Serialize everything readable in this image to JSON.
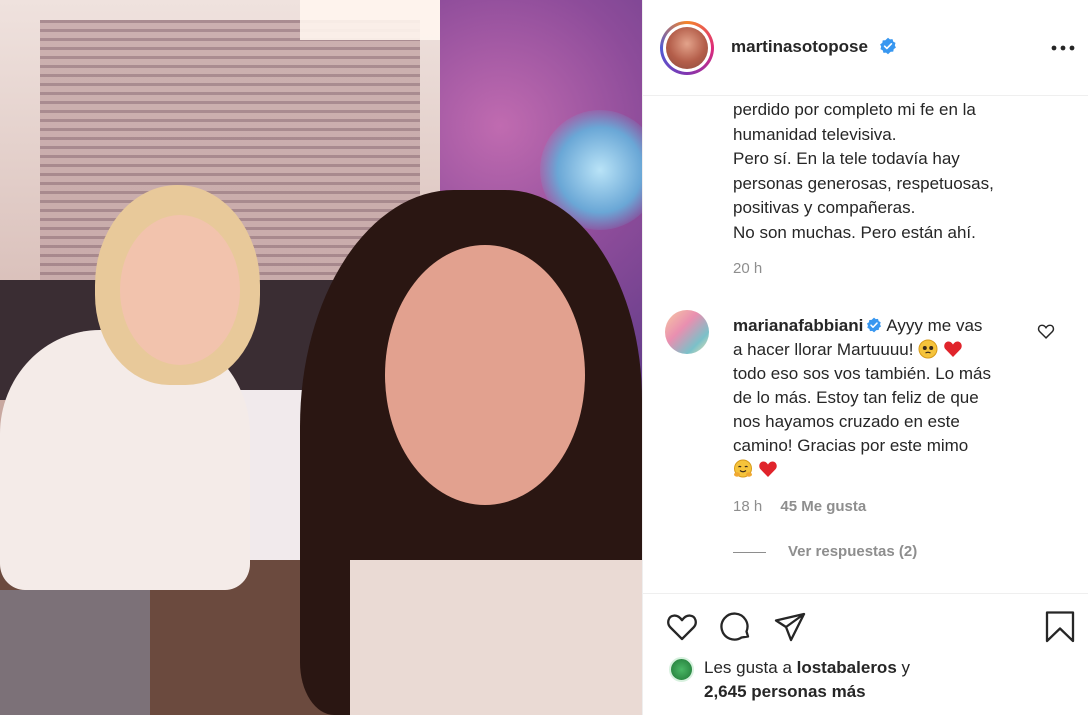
{
  "post": {
    "username": "martinasotopose",
    "caption_lines": [
      "perdido por completo mi fe en la",
      "humanidad televisiva.",
      "Pero sí. En la tele todavía hay",
      "personas generosas, respetuosas,",
      "positivas y compañeras.",
      "No son muchas. Pero están ahí."
    ],
    "caption_time": "20 h"
  },
  "comment": {
    "username": "marianafabbiani",
    "line1": "Ayyy me vas",
    "line2": "a hacer llorar Martuuuu!",
    "line3": "todo eso sos vos también. Lo más",
    "line4": "de lo más. Estoy tan feliz de que",
    "line5": "nos hayamos cruzado en este",
    "line6": "camino! Gracias por este mimo",
    "time": "18 h",
    "likes": "45 Me gusta",
    "replies": "Ver respuestas (2)"
  },
  "likes": {
    "prefix": "Les gusta a ",
    "user": "lostabaleros",
    "suffix": " y",
    "others": "2,645 personas más"
  },
  "icons": {
    "like": "heart-icon",
    "comment": "comment-icon",
    "share": "share-icon",
    "save": "bookmark-icon",
    "more": "more-icon",
    "verified": "verified-badge-icon"
  },
  "colors": {
    "verified": "#3897f0",
    "heart_red": "#ed4956",
    "text": "#262626",
    "muted": "#8e8e8e"
  }
}
